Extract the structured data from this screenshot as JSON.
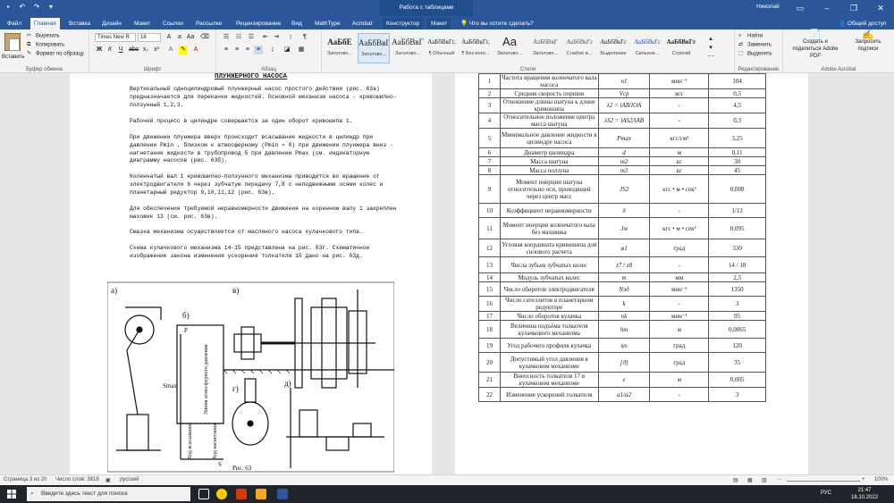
{
  "window": {
    "title": "РГЗ 63б - Word",
    "context_title": "Работа с таблицами",
    "user": "Николай"
  },
  "tabs": [
    "Файл",
    "Главная",
    "Вставка",
    "Дизайн",
    "Макет",
    "Ссылки",
    "Рассылки",
    "Рецензирование",
    "Вид",
    "MathType",
    "Acrobat",
    "Конструктор",
    "Макет"
  ],
  "tellme": "Что вы хотите сделать?",
  "share": "Общий доступ",
  "ribbon": {
    "clipboard": {
      "paste": "Вставить",
      "cut": "Вырезать",
      "copy": "Копировать",
      "format_painter": "Формат по образцу",
      "label": "Буфер обмена"
    },
    "font": {
      "name": "Times New R",
      "size": "16",
      "label": "Шрифт"
    },
    "paragraph": {
      "label": "Абзац"
    },
    "styles": {
      "label": "Стили",
      "items": [
        {
          "sample": "АаБбЕ",
          "name": "Заголово..."
        },
        {
          "sample": "АаБбВвГ",
          "name": "Заголово..."
        },
        {
          "sample": "АаБбВвГ",
          "name": "Заголово..."
        },
        {
          "sample": "АаБбВвГг,",
          "name": "¶ Обычный"
        },
        {
          "sample": "АаБбВвГг,",
          "name": "¶ Без инте..."
        },
        {
          "sample": "Аа",
          "name": "Заголово..."
        },
        {
          "sample": "АаБбВвГ",
          "name": "Заголово..."
        },
        {
          "sample": "АаБбВвГг",
          "name": "Слабое в..."
        },
        {
          "sample": "АаБбВвГг",
          "name": "Выделение"
        },
        {
          "sample": "АаБбВвГг",
          "name": "Сильное..."
        },
        {
          "sample": "АаБбВвГг",
          "name": "Строгий"
        }
      ]
    },
    "editing": {
      "find": "Найти",
      "replace": "Заменить",
      "select": "Выделить",
      "label": "Редактирование"
    },
    "acrobat": {
      "create": "Создать и поделиться Adobe PDF",
      "request": "Запросить подписи",
      "label": "Adobe Acrobat"
    }
  },
  "doc": {
    "title": "ПЛУНЖЕРНОГО НАСОСА",
    "paragraphs": [
      "Вертикальный одноцилиндровый плунжерный насос простого действия (рис. 63а) предназначается для перекачки жидкостей. Основной механизм насоса - кривошипно-ползунный 1,2,3.",
      "Рабочий процесс в цилиндре совершается за один оборот кривошипа 1.",
      "При движении плунжера вверх происходит всасывание жидкости в цилиндр при давлении Pmin , близком к атмосферному (Pmin ≈ 0) при движении плунжера вниз - нагнетание жидкости в трубопровод 5 при давлении Pmax (см. индикаторную диаграмму насосов (рис. 63б).",
      "Коленчатый вал 1 кривошипно-ползунного механизма приводится во вращение от электродвигателя 6 через зубчатую передачу 7,8 с неподвижными осями колес и планетарный редуктор 9,10,11,12 (рис. 63в).",
      "Для обеспечения требуемой неравномерности движения на коренном валу 1 закреплен маховик 13 (см. рис. 63в).",
      "Смазка механизма осуществляется от масляного насоса кулачкового типа.",
      "Схема кулачкового механизма 14-15 представлена на рис. 63г. Схематичное изображение закона изменения ускорения толкателя 15 дано на рис. 63д."
    ],
    "figure": {
      "caption": "Рис. 63",
      "labels": [
        "а)",
        "б)",
        "в)",
        "г)",
        "д)"
      ],
      "diagram_label": "Линия атмосферного давления",
      "axis_labels": [
        "P",
        "S",
        "Smax"
      ],
      "sublabels": [
        "Ход всасывания",
        "Ход нагнетания"
      ]
    }
  },
  "table": {
    "rows": [
      {
        "n": "1",
        "name": "Частота вращения коленчатого вала насоса",
        "sym": "n1",
        "unit": "мин⁻¹",
        "val": "104"
      },
      {
        "n": "2",
        "name": "Средняя скорость поршня",
        "sym": "Vср",
        "unit": "м/с",
        "val": "0,5"
      },
      {
        "n": "3",
        "name": "Отношение длины шатуна к длине кривошипа",
        "sym": "λ2 = lAB/lOA",
        "unit": "-",
        "val": "4,5"
      },
      {
        "n": "4",
        "name": "Относительное положение центра масса шатуна",
        "sym": "λS2 = lAS2/lAB",
        "unit": "-",
        "val": "0,3"
      },
      {
        "n": "5",
        "name": "Минимальное давление жидкости в цилиндре насоса",
        "sym": "Pmax",
        "unit": "кгс/см²",
        "val": "3,25"
      },
      {
        "n": "6",
        "name": "Диаметр цилиндра",
        "sym": "d",
        "unit": "м",
        "val": "0,11"
      },
      {
        "n": "7",
        "name": "Масса шатуна",
        "sym": "m2",
        "unit": "кг",
        "val": "30"
      },
      {
        "n": "8",
        "name": "Масса ползуна",
        "sym": "m3",
        "unit": "кг",
        "val": "45"
      },
      {
        "n": "9",
        "name": "Момент инерции шатуна относительно оси, проходящей через центр масс",
        "sym": "JS2",
        "unit": "кгс • м • сек²",
        "val": "0,008"
      },
      {
        "n": "10",
        "name": "Коэффициент неравномерности",
        "sym": "δ",
        "unit": "-",
        "val": "1/12"
      },
      {
        "n": "11",
        "name": "Момент инерции коленчатого вала без маховика",
        "sym": "Jм",
        "unit": "кгс • м • сек²",
        "val": "0,095"
      },
      {
        "n": "12",
        "name": "Угловая координата кривошипа для силового расчета",
        "sym": "φ1",
        "unit": "град",
        "val": "330"
      },
      {
        "n": "13",
        "name": "Числа зубьев зубчатых колес",
        "sym": "z7 / z8",
        "unit": "-",
        "val": "14 / 18"
      },
      {
        "n": "14",
        "name": "Модуль зубчатых колес",
        "sym": "m",
        "unit": "мм",
        "val": "2,5"
      },
      {
        "n": "15",
        "name": "Число оборотов электродвигателя",
        "sym": "Nэд",
        "unit": "мин⁻¹",
        "val": "1350"
      },
      {
        "n": "16",
        "name": "Число сателлитов в планетарном редукторе",
        "sym": "k",
        "unit": "-",
        "val": "3"
      },
      {
        "n": "17",
        "name": "Число оборотов кулачка",
        "sym": "nk",
        "unit": "мин⁻¹",
        "val": "95"
      },
      {
        "n": "18",
        "name": "Величина подъёма толкателя кулачкового механизма",
        "sym": "hт",
        "unit": "м",
        "val": "0,0065"
      },
      {
        "n": "19",
        "name": "Угол рабочего профиля кулачка",
        "sym": "ψs",
        "unit": "град",
        "val": "120"
      },
      {
        "n": "20",
        "name": "Допустимый угол давления в кулачковом механизме",
        "sym": "[ϑ]",
        "unit": "град",
        "val": "35"
      },
      {
        "n": "21",
        "name": "Внеосность толкателя 17 в кулачковом механизме",
        "sym": "e",
        "unit": "м",
        "val": "0,005"
      },
      {
        "n": "22",
        "name": "Изменение ускорений толкателя",
        "sym": "a1/a2",
        "unit": "-",
        "val": "3"
      }
    ]
  },
  "status": {
    "page": "Страница 3 из 20",
    "words": "Число слов: 3818",
    "lang": "русский",
    "zoom": "100%"
  },
  "taskbar": {
    "search": "Введите здесь текст для поиска",
    "lang": "РУС",
    "time": "21:47",
    "date": "16.10.2022"
  }
}
